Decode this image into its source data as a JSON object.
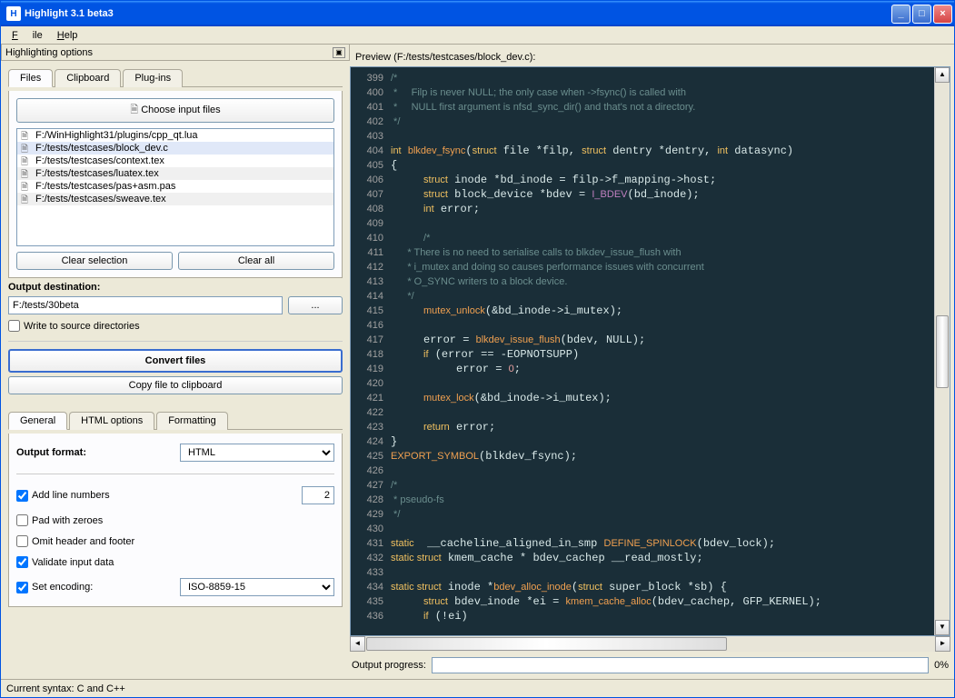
{
  "window": {
    "title": "Highlight 3.1 beta3"
  },
  "menu": {
    "file": "File",
    "help": "Help"
  },
  "left": {
    "header": "Highlighting options",
    "tabs": {
      "files": "Files",
      "clipboard": "Clipboard",
      "plugins": "Plug-ins"
    },
    "choose_input": "Choose input files",
    "files": [
      "F:/WinHighlight31/plugins/cpp_qt.lua",
      "F:/tests/testcases/block_dev.c",
      "F:/tests/testcases/context.tex",
      "F:/tests/testcases/luatex.tex",
      "F:/tests/testcases/pas+asm.pas",
      "F:/tests/testcases/sweave.tex"
    ],
    "clear_selection": "Clear selection",
    "clear_all": "Clear all",
    "output_dest_label": "Output destination:",
    "output_dest_value": "F:/tests/30beta",
    "browse": "...",
    "write_src": "Write to source directories",
    "convert": "Convert files",
    "copy_clip": "Copy file to clipboard"
  },
  "opts": {
    "tabs": {
      "general": "General",
      "html": "HTML options",
      "formatting": "Formatting"
    },
    "output_format_label": "Output format:",
    "output_format_value": "HTML",
    "add_ln": "Add line numbers",
    "ln_width": "2",
    "pad_zero": "Pad with zeroes",
    "omit_hf": "Omit header and footer",
    "validate": "Validate input data",
    "set_enc": "Set encoding:",
    "enc_value": "ISO-8859-15"
  },
  "preview": {
    "label": "Preview (F:/tests/testcases/block_dev.c):",
    "progress_label": "Output progress:",
    "progress_pct": "0%"
  },
  "status": {
    "syntax": "Current syntax: C and C++"
  },
  "code_lines": [
    {
      "n": 399,
      "h": "<span class='cmt'>/*</span>"
    },
    {
      "n": 400,
      "h": "<span class='cmt'> *     Filp is never NULL; the only case when -&gt;fsync() is called with</span>"
    },
    {
      "n": 401,
      "h": "<span class='cmt'> *     NULL first argument is nfsd_sync_dir() and that's not a directory.</span>"
    },
    {
      "n": 402,
      "h": "<span class='cmt'> */</span>"
    },
    {
      "n": 403,
      "h": ""
    },
    {
      "n": 404,
      "h": "<span class='kw'>int</span> <span class='fn'>blkdev_fsync</span>(<span class='kw'>struct</span> file *filp, <span class='kw'>struct</span> dentry *dentry, <span class='kw'>int</span> datasync)"
    },
    {
      "n": 405,
      "h": "{"
    },
    {
      "n": 406,
      "h": "     <span class='kw'>struct</span> inode *bd_inode = filp-&gt;f_mapping-&gt;host;"
    },
    {
      "n": 407,
      "h": "     <span class='kw'>struct</span> block_device *bdev = <span class='mac'>I_BDEV</span>(bd_inode);"
    },
    {
      "n": 408,
      "h": "     <span class='kw'>int</span> error;"
    },
    {
      "n": 409,
      "h": ""
    },
    {
      "n": 410,
      "h": "     <span class='cmt'>/*</span>"
    },
    {
      "n": 411,
      "h": "<span class='cmt'>      * There is no need to serialise calls to blkdev_issue_flush with</span>"
    },
    {
      "n": 412,
      "h": "<span class='cmt'>      * i_mutex and doing so causes performance issues with concurrent</span>"
    },
    {
      "n": 413,
      "h": "<span class='cmt'>      * O_SYNC writers to a block device.</span>"
    },
    {
      "n": 414,
      "h": "<span class='cmt'>      */</span>"
    },
    {
      "n": 415,
      "h": "     <span class='fn'>mutex_unlock</span>(&amp;bd_inode-&gt;i_mutex);"
    },
    {
      "n": 416,
      "h": ""
    },
    {
      "n": 417,
      "h": "     error = <span class='fn'>blkdev_issue_flush</span>(bdev, NULL);"
    },
    {
      "n": 418,
      "h": "     <span class='kw'>if</span> (error == -EOPNOTSUPP)"
    },
    {
      "n": 419,
      "h": "          error = <span class='num'>0</span>;"
    },
    {
      "n": 420,
      "h": ""
    },
    {
      "n": 421,
      "h": "     <span class='fn'>mutex_lock</span>(&amp;bd_inode-&gt;i_mutex);"
    },
    {
      "n": 422,
      "h": ""
    },
    {
      "n": 423,
      "h": "     <span class='kw'>return</span> error;"
    },
    {
      "n": 424,
      "h": "}"
    },
    {
      "n": 425,
      "h": "<span class='fn'>EXPORT_SYMBOL</span>(blkdev_fsync);"
    },
    {
      "n": 426,
      "h": ""
    },
    {
      "n": 427,
      "h": "<span class='cmt'>/*</span>"
    },
    {
      "n": 428,
      "h": "<span class='cmt'> * pseudo-fs</span>"
    },
    {
      "n": 429,
      "h": "<span class='cmt'> */</span>"
    },
    {
      "n": 430,
      "h": ""
    },
    {
      "n": 431,
      "h": "<span class='kw'>static</span>  __cacheline_aligned_in_smp <span class='fn'>DEFINE_SPINLOCK</span>(bdev_lock);"
    },
    {
      "n": 432,
      "h": "<span class='kw'>static struct</span> kmem_cache * bdev_cachep __read_mostly;"
    },
    {
      "n": 433,
      "h": ""
    },
    {
      "n": 434,
      "h": "<span class='kw'>static struct</span> inode *<span class='fn'>bdev_alloc_inode</span>(<span class='kw'>struct</span> super_block *sb) {"
    },
    {
      "n": 435,
      "h": "     <span class='kw'>struct</span> bdev_inode *ei = <span class='fn'>kmem_cache_alloc</span>(bdev_cachep, GFP_KERNEL);"
    },
    {
      "n": 436,
      "h": "     <span class='kw'>if</span> (!ei)"
    }
  ]
}
